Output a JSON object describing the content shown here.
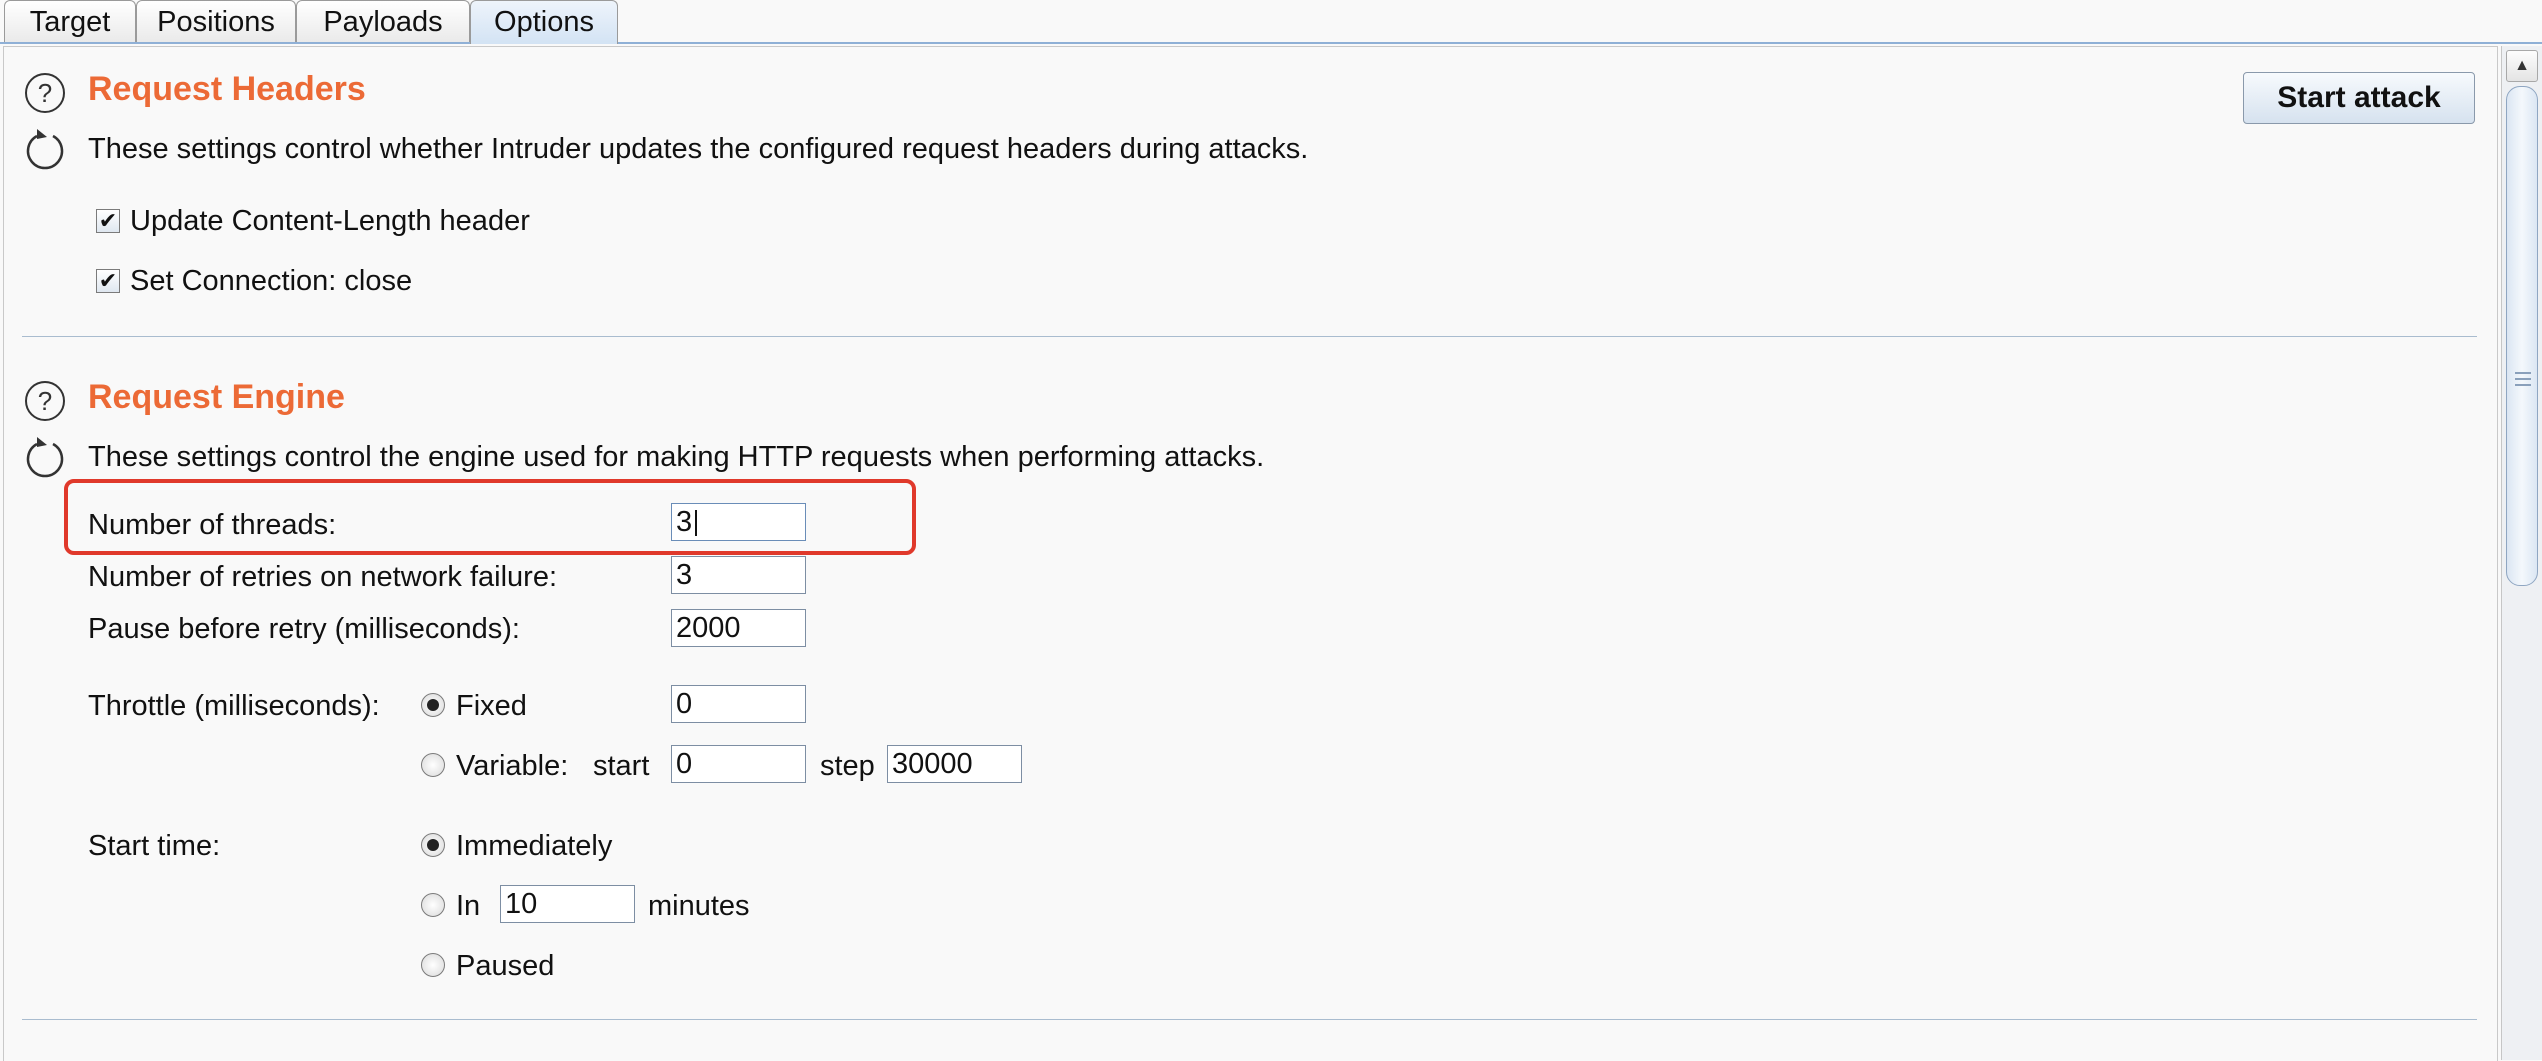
{
  "tabs": [
    {
      "label": "Target",
      "active": false
    },
    {
      "label": "Positions",
      "active": false
    },
    {
      "label": "Payloads",
      "active": false
    },
    {
      "label": "Options",
      "active": true
    }
  ],
  "start_attack_label": "Start attack",
  "icons": {
    "help": "question-circle-icon",
    "reset": "refresh-icon"
  },
  "colors": {
    "section_title": "#ec6a36",
    "highlight": "#e0392b",
    "active_tab": "#d3e3f4"
  },
  "request_headers": {
    "title": "Request Headers",
    "description": "These settings control whether Intruder updates the configured request headers during attacks.",
    "options": [
      {
        "label": "Update Content-Length header",
        "checked": true
      },
      {
        "label": "Set Connection: close",
        "checked": true
      }
    ]
  },
  "request_engine": {
    "title": "Request Engine",
    "description": "These settings control the engine used for making HTTP requests when performing attacks.",
    "threads": {
      "label": "Number of threads:",
      "value": "3"
    },
    "retries": {
      "label": "Number of retries on network failure:",
      "value": "3"
    },
    "pause": {
      "label": "Pause before retry (milliseconds):",
      "value": "2000"
    },
    "throttle": {
      "label": "Throttle (milliseconds):",
      "fixed": {
        "label": "Fixed",
        "selected": true,
        "value": "0"
      },
      "variable": {
        "label": "Variable:",
        "selected": false,
        "start_label": "start",
        "start_value": "0",
        "step_label": "step",
        "step_value": "30000"
      }
    },
    "start_time": {
      "label": "Start time:",
      "immediately": {
        "label": "Immediately",
        "selected": true
      },
      "in": {
        "label": "In",
        "selected": false,
        "value": "10",
        "unit": "minutes"
      },
      "paused": {
        "label": "Paused",
        "selected": false
      }
    }
  }
}
